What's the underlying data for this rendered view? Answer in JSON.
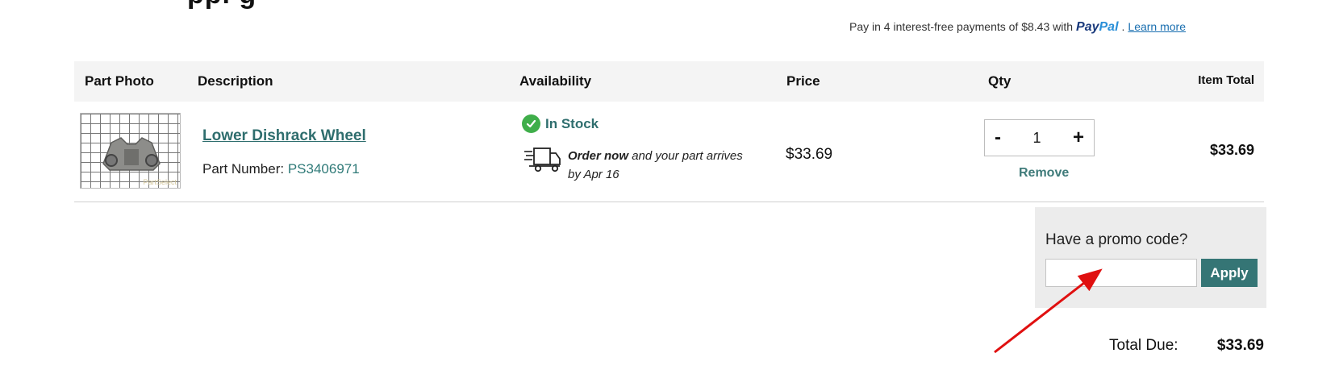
{
  "header": {
    "title_fragment": "ppi g"
  },
  "paypal": {
    "message": "Pay in 4 interest-free payments of $8.43 with",
    "logo_pay": "Pay",
    "logo_pal": "Pal",
    "dot": ".",
    "learn_more": "Learn more"
  },
  "table": {
    "columns": {
      "photo": "Part Photo",
      "description": "Description",
      "availability": "Availability",
      "price": "Price",
      "qty": "Qty",
      "item_total": "Item Total"
    },
    "item": {
      "name": "Lower Dishrack Wheel",
      "part_number_label": "Part Number:",
      "part_number": "PS3406971",
      "photo_watermark": "PartSelect",
      "stock_status": "In Stock",
      "delivery_bold": "Order now",
      "delivery_rest": "and your part arrives by Apr 16",
      "price": "$33.69",
      "qty_minus": "-",
      "qty": "1",
      "qty_plus": "+",
      "remove": "Remove",
      "item_total": "$33.69"
    }
  },
  "promo": {
    "label": "Have a promo code?",
    "input_value": "",
    "apply": "Apply"
  },
  "summary": {
    "total_label": "Total Due:",
    "total_value": "$33.69"
  },
  "colors": {
    "accent": "#357575",
    "link": "#2f6e6e",
    "in_stock": "#3fae4a",
    "annotation": "#e01010"
  },
  "icons": [
    "check-circle-icon",
    "delivery-truck-icon"
  ]
}
